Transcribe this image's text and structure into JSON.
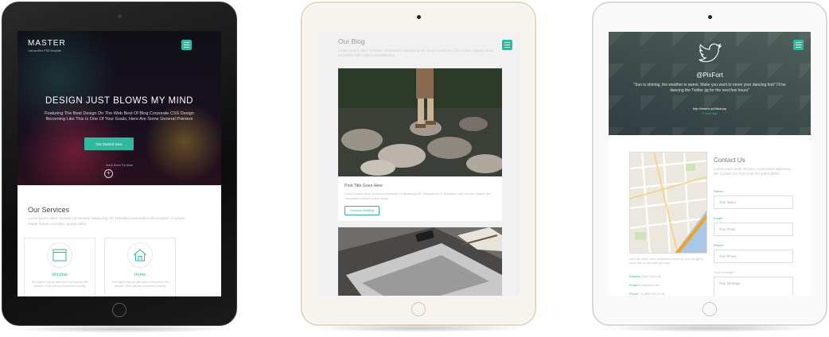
{
  "accent": "#2fb99f",
  "device1": {
    "brand": "MASTER",
    "brand_sub": "Just another PSD template",
    "hero_title": "DESIGN JUST BLOWS MY MIND",
    "hero_text": "Featuring The Best Design On The Web Best Of Blog Corporate CSS Design Becoming Like This Is One Of Your Goals, Here Are Some General Pointers",
    "cta_label": "Get Started Now",
    "scroll_label": "Scroll Down For More",
    "services_title": "Our Services",
    "services_text": "Lorem ipsum dolor sit amet consectetur adipiscing elit. Expedita possessitur elit excepturi. In ipsum neque harum concepto, quque nulla!",
    "cards": [
      {
        "icon": "window-icon",
        "label": "Window",
        "text": "The pages may be attended in proportion the hamper. If the actions hammered exactly"
      },
      {
        "icon": "home-icon",
        "label": "Home",
        "text": "The pages may be attended in proportion the hamper. If the actions hammered exactly"
      }
    ]
  },
  "device2": {
    "blog_title": "Our Blog",
    "blog_text": "Lorem ipsum dolor sit amet, consectetur adipisicing elit. Quasi possimus dolor natus repellat modi ea similar with adipisci repudiandae.",
    "post_title": "Post Title Goes Here",
    "post_text": "Lorem ipsum dolor sit amet consectetur adipisicing elit. Temporibus in quisquam non minima, eaque quo voluptatem debitis culpa neque.",
    "post_button": "Continue Reading"
  },
  "device3": {
    "twitter_handle": "@PixFort",
    "tweet": "\"Sun is shining, the weather is sweet. Make you want to move your dancing feet\" I'll be dancing the Twitter-jig for the next few hours\"",
    "tweet_link": "http://lirwuls.ly/18wxuuy",
    "tweet_time": "2 hours ago",
    "map_note": "Here are some more informations about us, you can get in touch with us any time you want.",
    "address_label": "Address:",
    "address_value": "New York City",
    "email_label": "Email:",
    "email_value": "info@gmail.com",
    "phone_label": "Phone:",
    "phone_value": "+1(555) 565 42 18",
    "contact_title": "Contact Us",
    "contact_text": "Lorem ipsum dolor sit amet, consectetur adipiscing elit. Contact me, from 9:00 AM until 5:30PM",
    "form": {
      "name_label": "Name*",
      "name_placeholder": "Your Name",
      "email_label": "Email*",
      "email_placeholder": "Your Email",
      "phone_label": "Phone*",
      "phone_placeholder": "Your Phone",
      "message_label": "Your message*",
      "message_placeholder": "Your Message"
    }
  }
}
